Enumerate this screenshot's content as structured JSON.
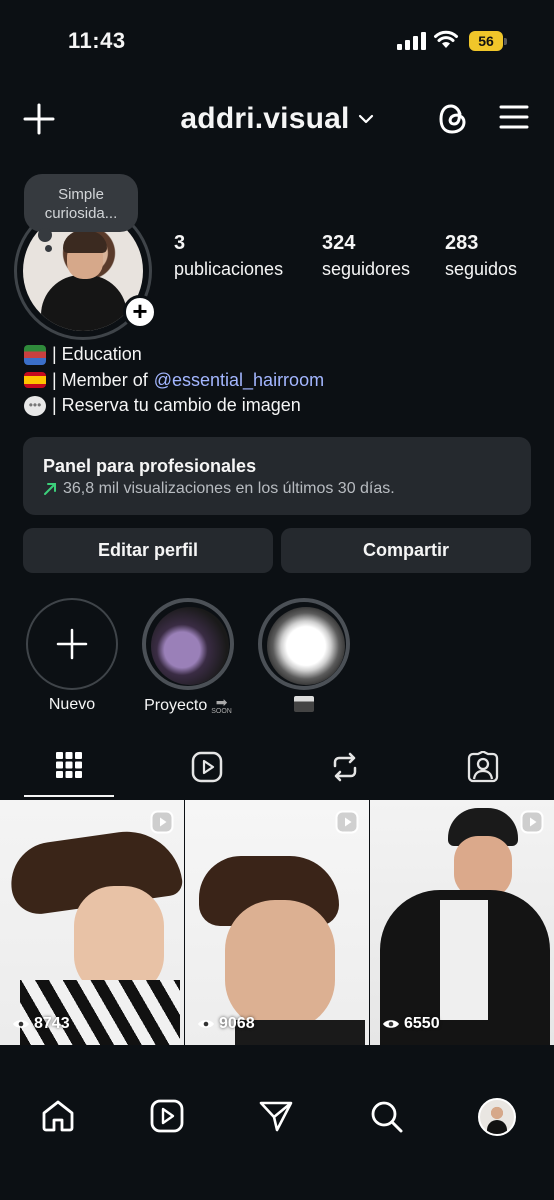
{
  "status_bar": {
    "time": "11:43",
    "battery": "56"
  },
  "header": {
    "username": "addri.visual"
  },
  "note": {
    "text": "Simple curiosida..."
  },
  "stats": [
    {
      "value": "3",
      "label": "publicaciones"
    },
    {
      "value": "324",
      "label": "seguidores"
    },
    {
      "value": "283",
      "label": "seguidos"
    }
  ],
  "bio": {
    "line1": "| Education",
    "line2_prefix": "| Member of",
    "line2_mention": "@essential_hairroom",
    "line3": "| Reserva tu cambio de imagen"
  },
  "professional_panel": {
    "title": "Panel para profesionales",
    "subtitle": "36,8 mil visualizaciones en los últimos 30 días."
  },
  "buttons": {
    "edit": "Editar perfil",
    "share": "Compartir"
  },
  "highlights": [
    {
      "label": "Nuevo"
    },
    {
      "label": "Proyecto",
      "badge": "SOON"
    },
    {
      "label": ""
    }
  ],
  "posts": [
    {
      "views": "8743"
    },
    {
      "views": "9068"
    },
    {
      "views": "6550"
    }
  ],
  "colors": {
    "background": "#0c1014",
    "mention": "#a3b6ff",
    "battery": "#f0c62a"
  }
}
